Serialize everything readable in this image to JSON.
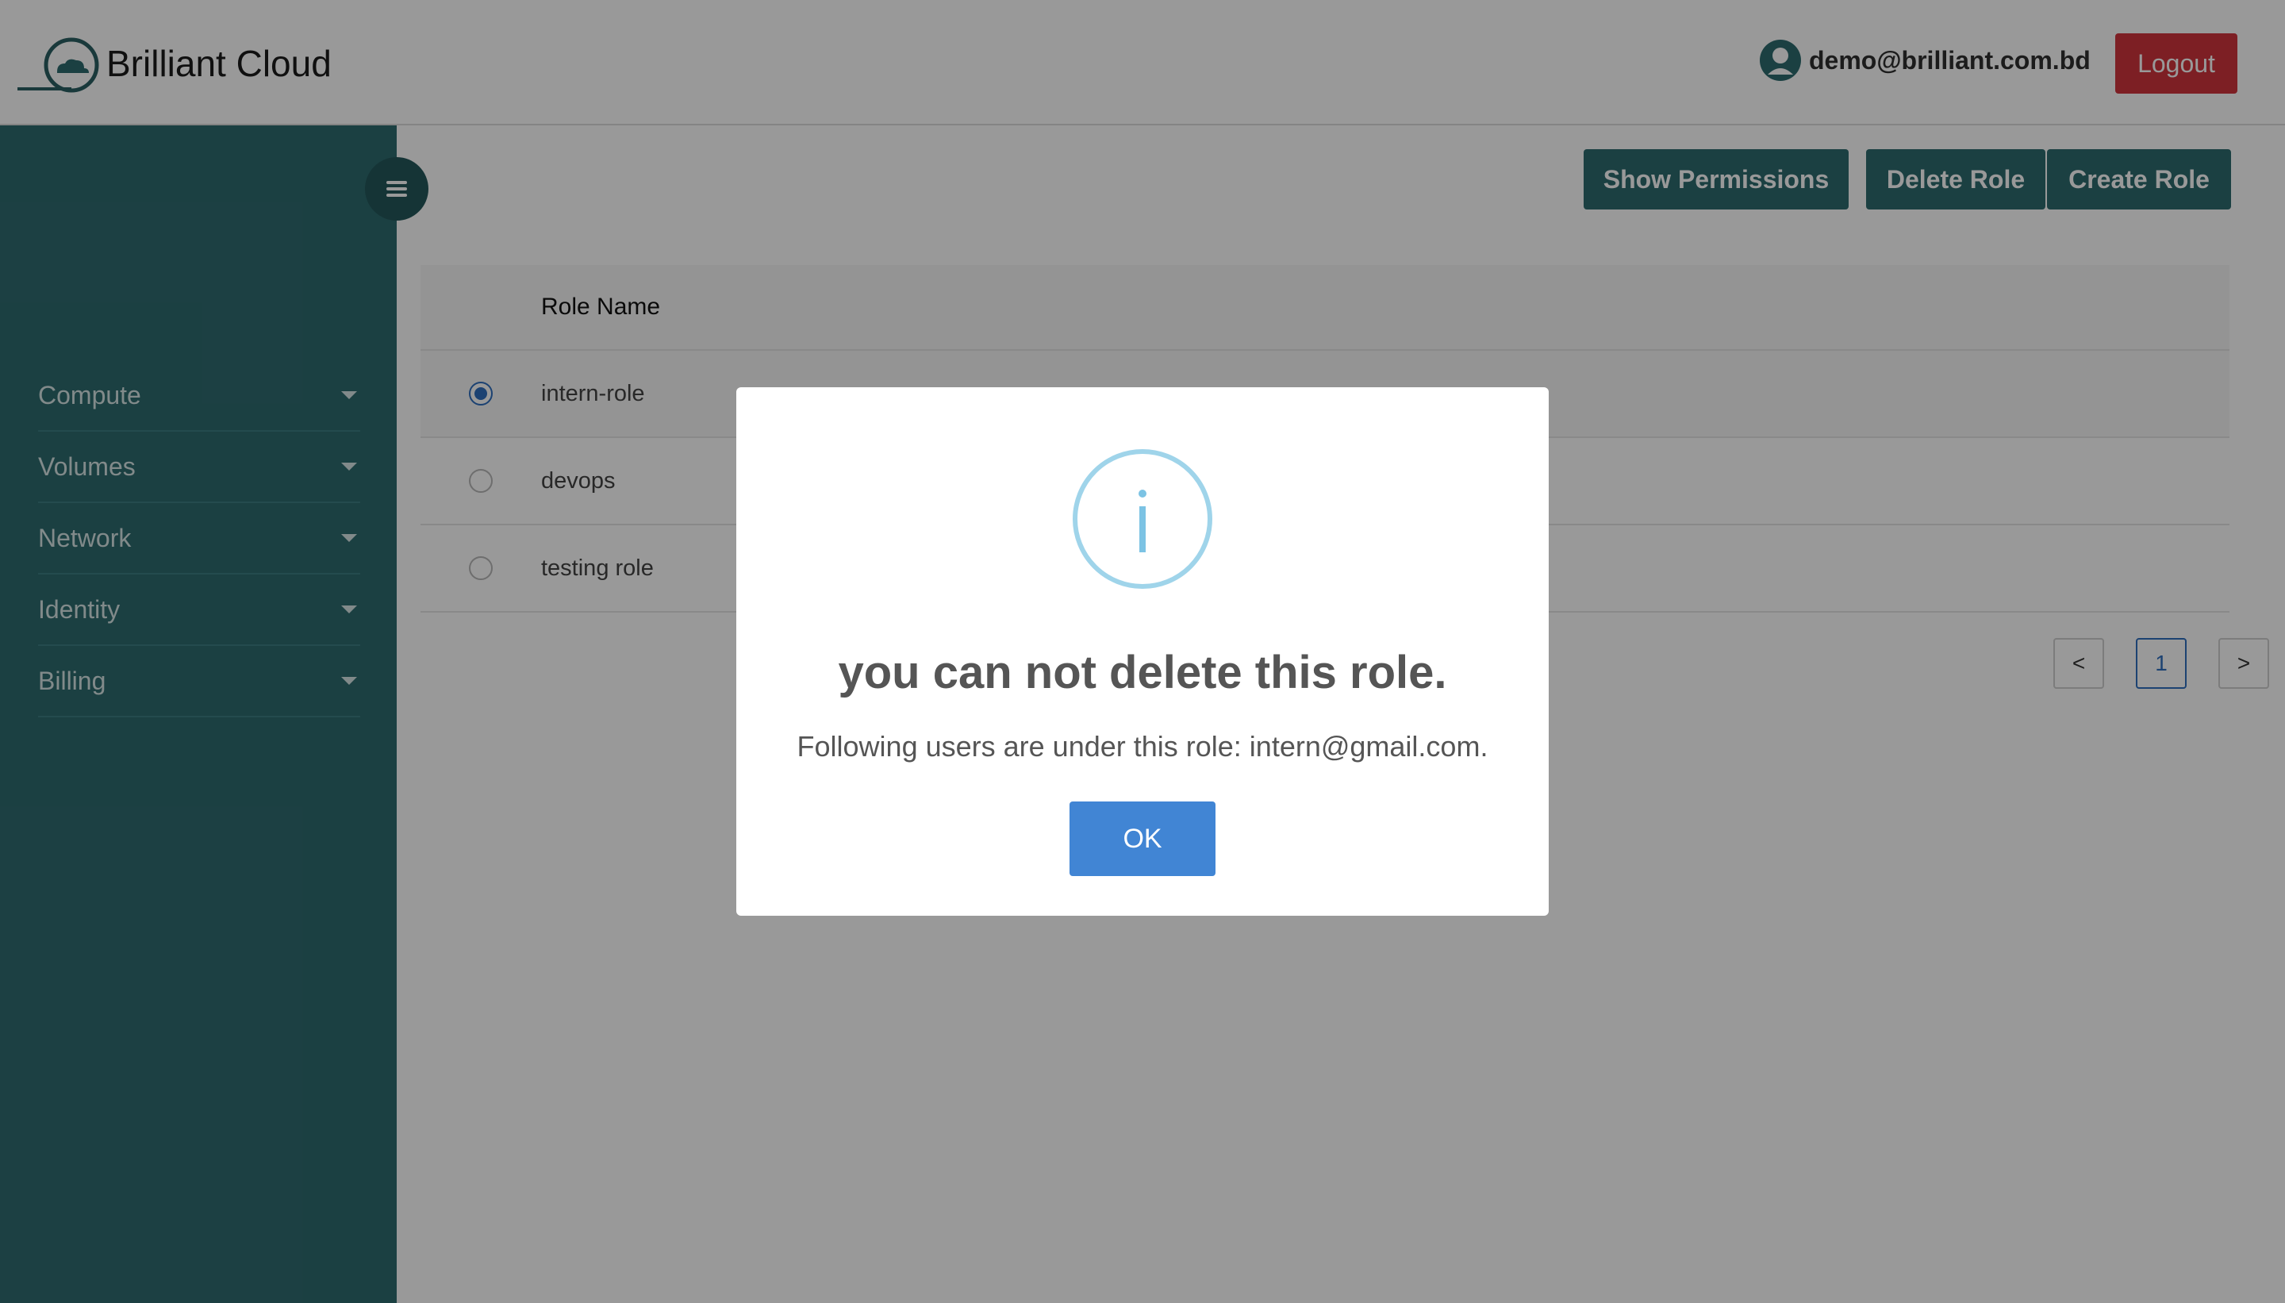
{
  "header": {
    "brand": "Brilliant Cloud",
    "user_email": "demo@brilliant.com.bd",
    "logout_label": "Logout"
  },
  "sidebar": {
    "items": [
      {
        "label": "Compute",
        "icon": "caret-down-icon"
      },
      {
        "label": "Volumes",
        "icon": "caret-down-icon"
      },
      {
        "label": "Network",
        "icon": "caret-down-icon"
      },
      {
        "label": "Identity",
        "icon": "caret-down-icon"
      },
      {
        "label": "Billing",
        "icon": "caret-down-icon"
      }
    ]
  },
  "toolbar": {
    "show_permissions": "Show Permissions",
    "delete_role": "Delete Role",
    "create_role": "Create Role"
  },
  "table": {
    "header": "Role Name",
    "rows": [
      {
        "name": "intern-role",
        "selected": true
      },
      {
        "name": "devops",
        "selected": false
      },
      {
        "name": "testing role",
        "selected": false
      }
    ]
  },
  "pagination": {
    "prev": "<",
    "page": "1",
    "next": ">"
  },
  "modal": {
    "icon": "info-icon",
    "title": "you can not delete this role.",
    "message": "Following users are under this role: intern@gmail.com.",
    "ok_label": "OK"
  },
  "colors": {
    "sidebar": "#2e6b6f",
    "primary_button": "#2e6b6f",
    "logout": "#d0343c",
    "ok": "#4185d4",
    "info_ring": "#9fd4ea"
  }
}
